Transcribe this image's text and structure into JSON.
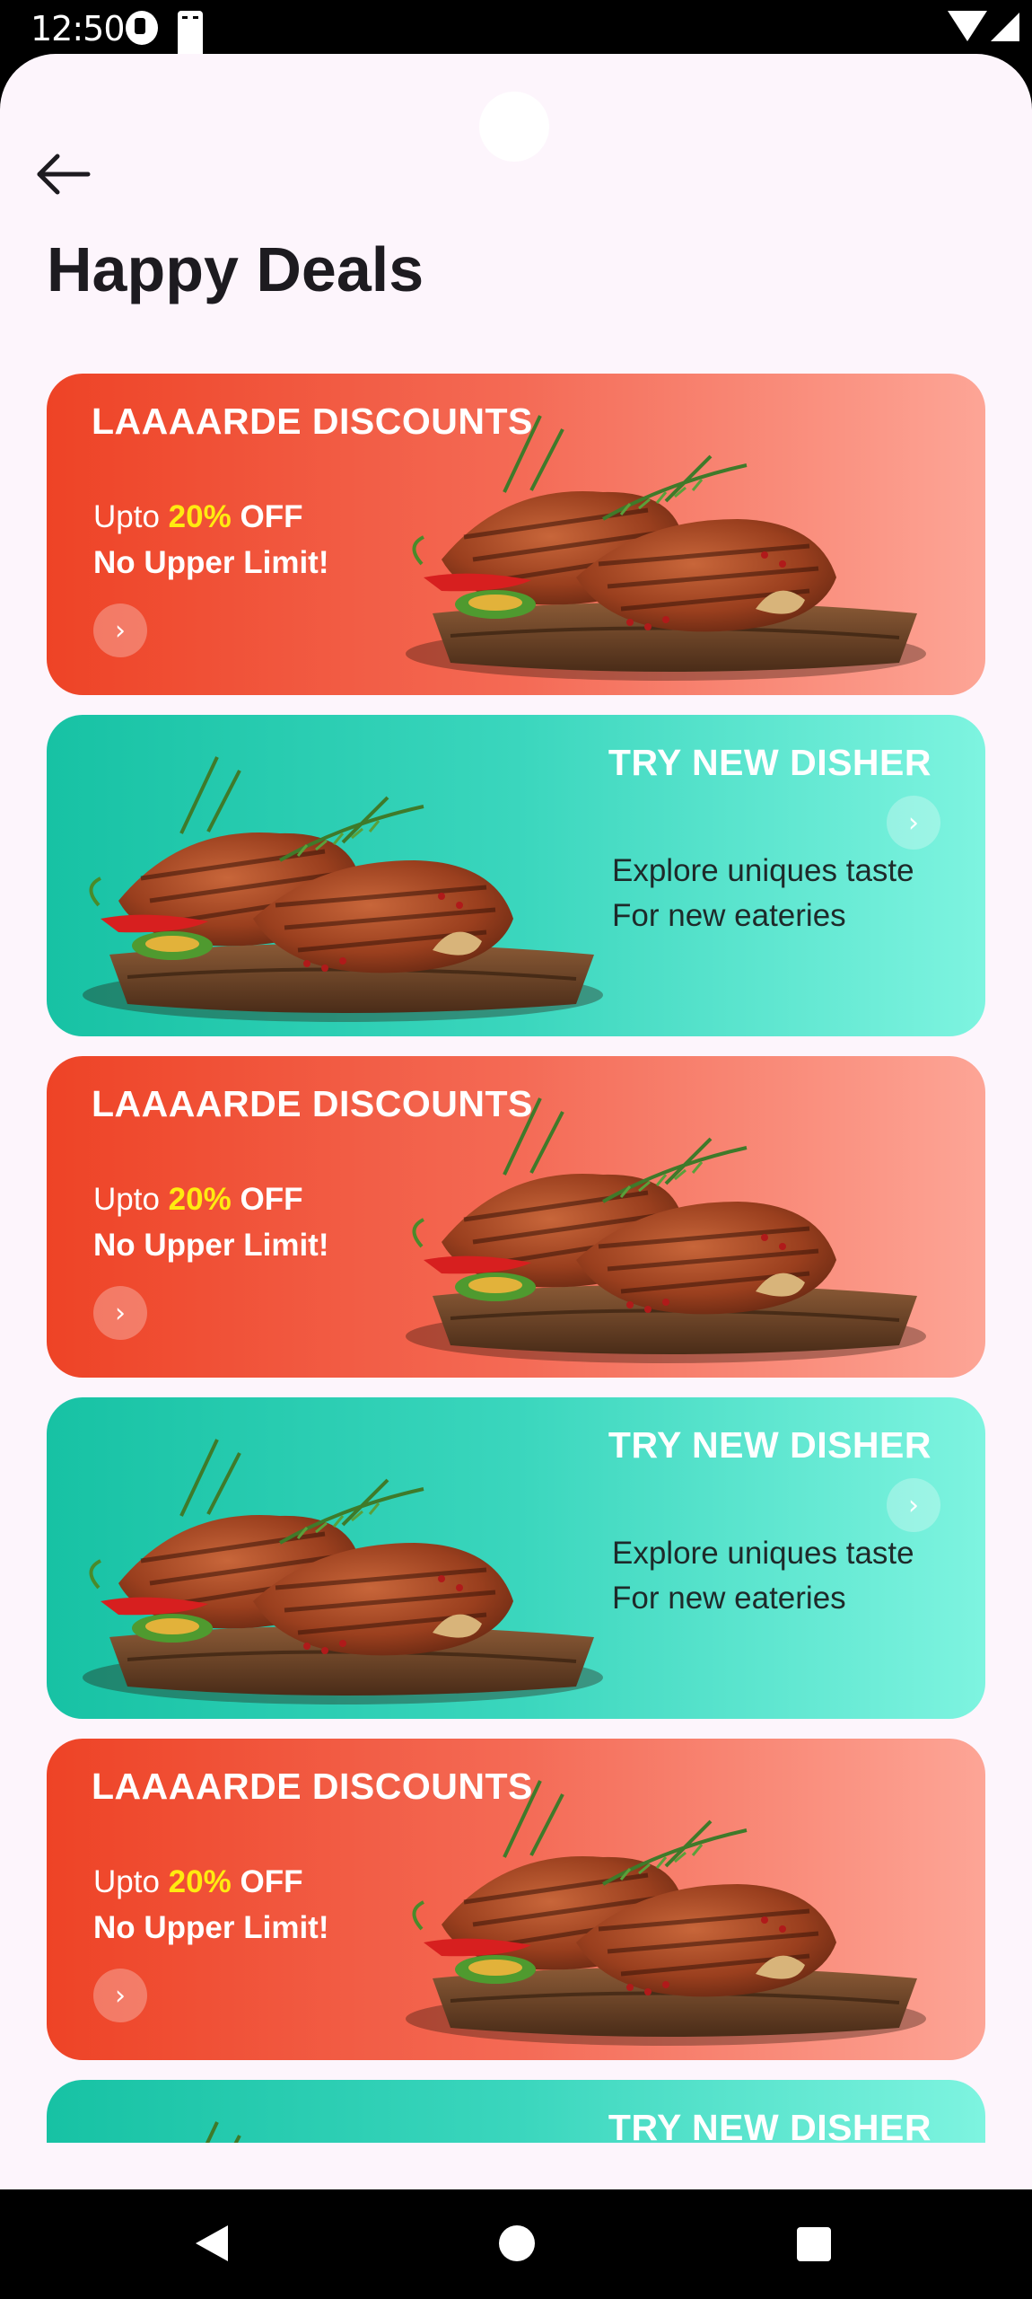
{
  "status_bar": {
    "time": "12:50",
    "icons": [
      "data-saver-icon",
      "sim-card-icon",
      "wifi-icon",
      "signal-icon"
    ]
  },
  "header": {
    "back_icon": "arrow-left-icon",
    "title": "Happy Deals"
  },
  "deals": [
    {
      "type": "discount",
      "title": "LAAAARDE DISCOUNTS",
      "offer_prefix": "Upto",
      "offer_percent": "20%",
      "offer_suffix": "OFF",
      "limit": "No Upper Limit!"
    },
    {
      "type": "try",
      "title": "TRY NEW DISHER",
      "line1": "Explore uniques taste",
      "line2": "For new eateries"
    },
    {
      "type": "discount",
      "title": "LAAAARDE DISCOUNTS",
      "offer_prefix": "Upto",
      "offer_percent": "20%",
      "offer_suffix": "OFF",
      "limit": "No Upper Limit!"
    },
    {
      "type": "try",
      "title": "TRY NEW DISHER",
      "line1": "Explore uniques taste",
      "line2": "For new eateries"
    },
    {
      "type": "discount",
      "title": "LAAAARDE DISCOUNTS",
      "offer_prefix": "Upto",
      "offer_percent": "20%",
      "offer_suffix": "OFF",
      "limit": "No Upper Limit!"
    },
    {
      "type": "try",
      "title": "TRY NEW DISHER"
    }
  ],
  "colors": {
    "discount_start": "#ee4326",
    "discount_end": "#fda596",
    "try_start": "#17c2a4",
    "try_end": "#7ef4e0",
    "highlight": "#ffeb10",
    "background": "#fdf5fc"
  },
  "nav_bar": {
    "buttons": [
      "back-triangle-icon",
      "home-circle-icon",
      "recents-square-icon"
    ]
  }
}
